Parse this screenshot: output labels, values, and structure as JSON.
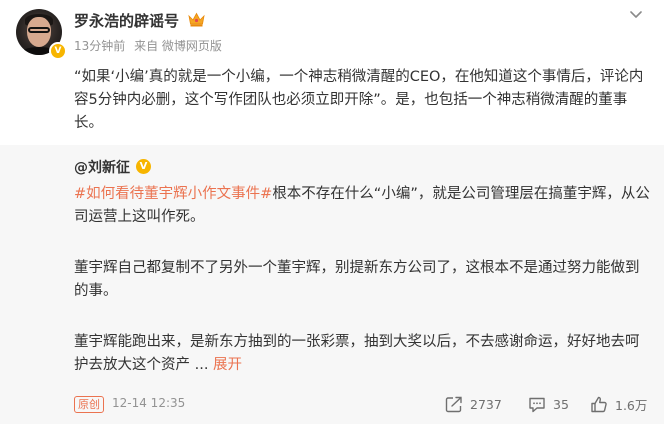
{
  "post": {
    "username": "罗永浩的辟谣号",
    "time": "13分钟前",
    "source": "来自 微博网页版",
    "text": "“如果‘小编’真的就是一个小编，一个神志稍微清醒的CEO，在他知道这个事情后，评论内容5分钟内必删，这个写作团队也必须立即开除”。是，也包括一个神志稍微清醒的董事长。"
  },
  "repost": {
    "author": "@刘新征",
    "hashtag": "#如何看待董宇辉小作文事件#",
    "para1_rest": "根本不存在什么“小编”，就是公司管理层在搞董宇辉，从公司运营上这叫作死。",
    "para2": "董宇辉自己都复制不了另外一个董宇辉，别提新东方公司了，这根本不是通过努力能做到的事。",
    "para3": "董宇辉能跑出来，是新东方抽到的一张彩票，抽到大奖以后，不去感谢命运，好好地去呵护去放大这个资产 ...",
    "expand_label": "展开",
    "tag_label": "原创",
    "timestamp": "12-14 12:35",
    "reposts": "2737",
    "comments": "35",
    "likes": "1.6万"
  },
  "colors": {
    "accent": "#eb7350",
    "verified": "#f7b500",
    "muted": "#939393",
    "repost_bg": "#f7f7f7"
  }
}
